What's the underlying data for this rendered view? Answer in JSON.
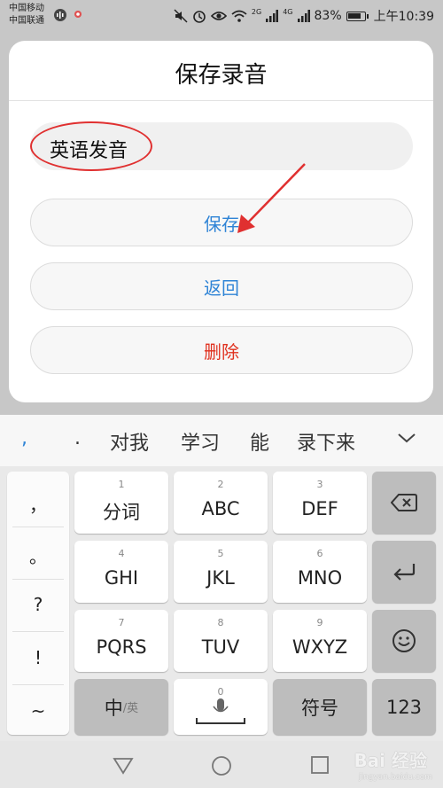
{
  "status_bar": {
    "carrier_1": "中国移动",
    "carrier_2": "中国联通",
    "network_1": "2G",
    "network_2": "4G",
    "battery": "83%",
    "time": "上午10:39",
    "icons": [
      "voice-icon",
      "notification-icon",
      "mute-icon",
      "alarm-icon",
      "eye-icon",
      "wifi-icon",
      "signal-icon",
      "battery-icon"
    ]
  },
  "dialog": {
    "title": "保存录音",
    "name_value": "英语发音",
    "save_label": "保存",
    "back_label": "返回",
    "delete_label": "删除"
  },
  "candidates": {
    "comma": ",",
    "dot": ".",
    "items": [
      "对我",
      "学习",
      "能",
      "录下来"
    ]
  },
  "keyboard": {
    "punctuation": [
      "，",
      "。",
      "?",
      "!",
      "~"
    ],
    "rows": [
      [
        {
          "num": "1",
          "label": "分词"
        },
        {
          "num": "2",
          "label": "ABC"
        },
        {
          "num": "3",
          "label": "DEF"
        }
      ],
      [
        {
          "num": "4",
          "label": "GHI"
        },
        {
          "num": "5",
          "label": "JKL"
        },
        {
          "num": "6",
          "label": "MNO"
        }
      ],
      [
        {
          "num": "7",
          "label": "PQRS"
        },
        {
          "num": "8",
          "label": "TUV"
        },
        {
          "num": "9",
          "label": "WXYZ"
        }
      ]
    ],
    "lang_main": "中",
    "lang_sub": "/英",
    "space_num": "0",
    "symbol_label": "符号",
    "numeric_label": "123"
  },
  "watermark": {
    "brand": "Bai 经验",
    "url": "jingyan.baidu.com"
  },
  "colors": {
    "accent_blue": "#2f84d6",
    "danger_red": "#e0301e",
    "annotation_red": "#e03030"
  }
}
